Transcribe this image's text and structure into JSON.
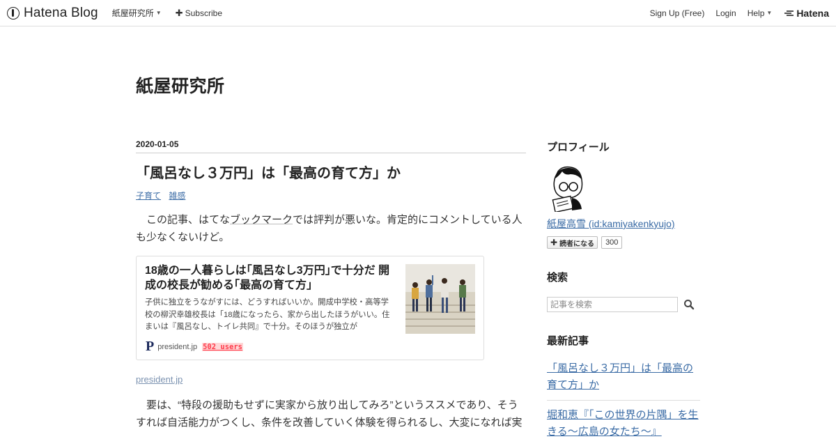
{
  "header": {
    "logo_text": "Hatena Blog",
    "blog_menu_label": "紙屋研究所",
    "subscribe_label": "Subscribe",
    "signup_label": "Sign Up (Free)",
    "login_label": "Login",
    "help_label": "Help",
    "hatena_label": "Hatena"
  },
  "blog": {
    "title": "紙屋研究所"
  },
  "entry": {
    "date": "2020-01-05",
    "title": "「風呂なし３万円」は「最高の育て方」か",
    "categories": [
      "子育て",
      "雑感"
    ],
    "para1_before": "この記事、はてな",
    "para1_link": "ブックマーク",
    "para1_after": "では評判が悪いな。肯定的にコメントしている人も少なくないけど。",
    "embed": {
      "title": "18歳の一人暮らしは｢風呂なし3万円｣で十分だ 開成の校長が勧める｢最高の育て方｣",
      "description": "子供に独立をうながすには、どうすればいいか。開成中学校・高等学校の柳沢幸雄校長は「18歳になったら、家から出したほうがいい。住まいは『風呂なし、トイレ共同』で十分。そのほうが独立が",
      "favicon": "P",
      "site": "president.jp",
      "users": "502 users"
    },
    "source_link": "president.jp",
    "para2": "要は、“特段の援助もせずに実家から放り出してみろ”というススメであり、そうすれば自活能力がつくし、条件を改善していく体験を得られるし、大変になれば実"
  },
  "sidebar": {
    "profile_heading": "プロフィール",
    "profile_name": "紙屋高雪 (id:kamiyakenkyujo)",
    "reader_button": "読者になる",
    "reader_count": "300",
    "search_heading": "検索",
    "search_placeholder": "記事を検索",
    "recent_heading": "最新記事",
    "recent": [
      "「風呂なし３万円」は「最高の育て方」か",
      "堀和恵『「この世界の片隅」を生きる〜広島の女たち〜』"
    ]
  },
  "colors": {
    "link": "#3a6ba5",
    "users_badge": "#ff3a4a",
    "border": "#dddddd"
  }
}
